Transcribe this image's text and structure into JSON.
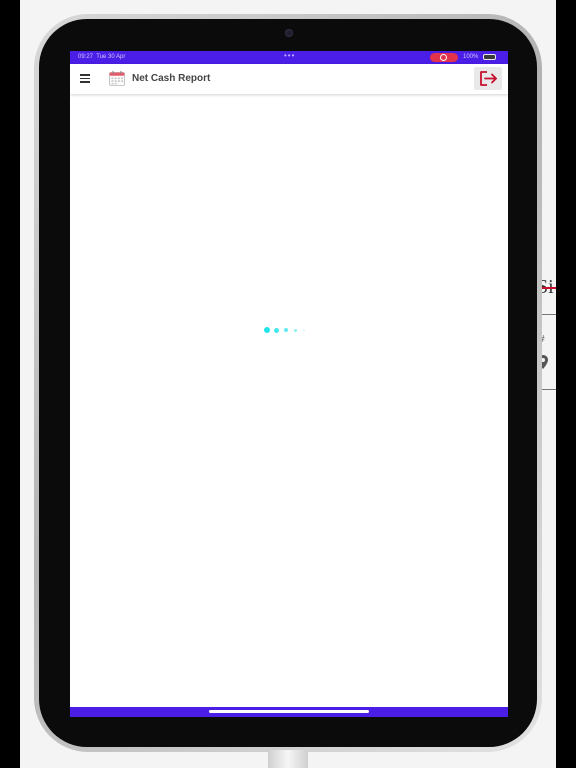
{
  "status_bar": {
    "time": "09:27",
    "date": "Tue 30 Apr",
    "dots": "•••",
    "battery_percent": "100%",
    "battery_level": 1.0,
    "bar_color": "#4a1ee6",
    "record_color": "#e2334a"
  },
  "header": {
    "title": "Net Cash Report",
    "menu_icon": "hamburger-menu-icon",
    "report_icon": "calendar-icon",
    "logout_icon": "logout-icon",
    "logout_color": "#c8102e"
  },
  "loader": {
    "color": "#22e3e8",
    "icon": "loading-dots-icon"
  },
  "background_peek": {
    "text": "Si",
    "hash": "#"
  }
}
